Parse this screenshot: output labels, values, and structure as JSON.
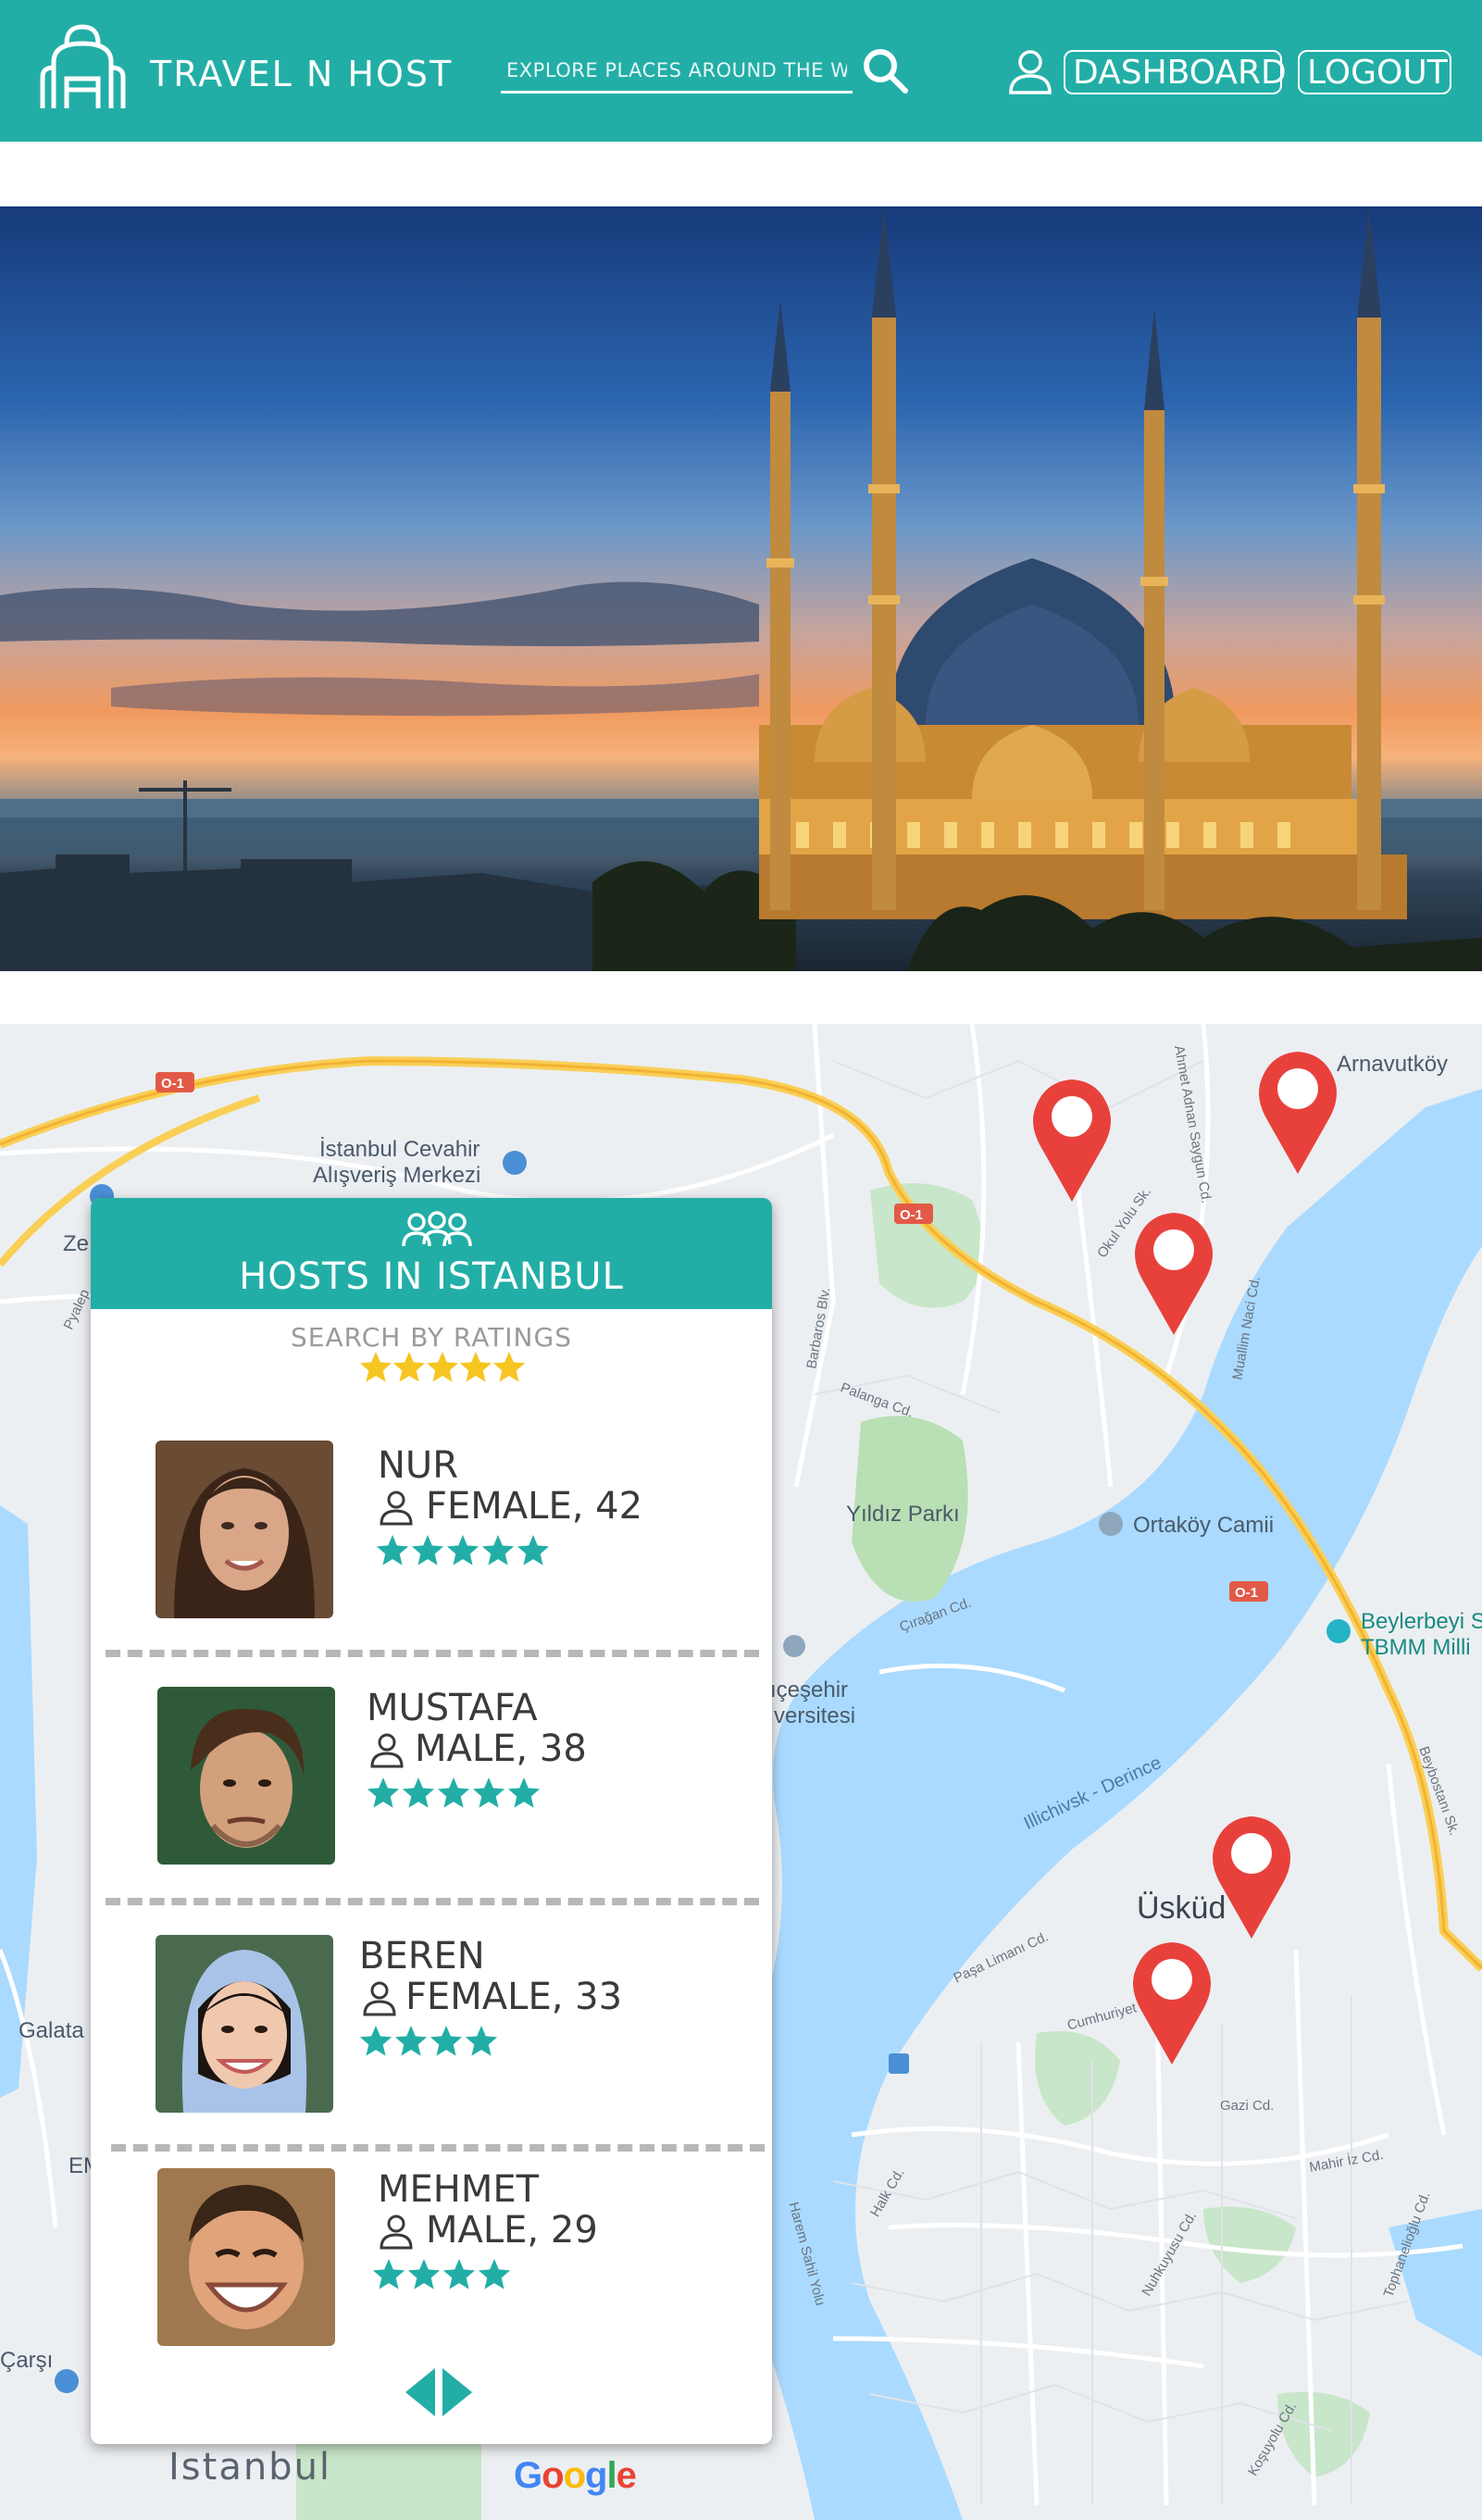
{
  "header": {
    "brand": "TRAVEL N HOST",
    "search_placeholder": "EXPLORE PLACES AROUND THE WORLD",
    "dashboard_label": "DASHBOARD",
    "logout_label": "LOGOUT",
    "icons": [
      "backpack-icon",
      "search-icon",
      "user-icon"
    ],
    "colors": {
      "primary": "#22aea6",
      "text": "#ffffff"
    }
  },
  "hero": {
    "image": "Blue Mosque at sunset, Istanbul"
  },
  "map": {
    "labels": {
      "istanbul_cevahir": "İstanbul Cevahir",
      "alisveris": "Alışveriş Merkezi",
      "arnavutkoy": "Arnavutköy",
      "yildiz": "Yıldız Parkı",
      "ortakoy": "Ortaköy Camii",
      "beylerbeyi": "Beylerbeyi S",
      "tbmm": "TBMM Milli",
      "cesehir": "ıçeşehir",
      "versitesi": "versitesi",
      "uskudar": "Üsküd",
      "galata": "Galata",
      "istanbul": "Istanbul",
      "ze": "Ze",
      "carsi": "Çarşı",
      "road_o1": "O-1",
      "illichivsk": "Illichivsk - Derince",
      "muallim": "Muallim Naci Cd.",
      "barbaros": "Barbaros Blv.",
      "palanga": "Palanga Cd.",
      "ciragan": "Çırağan Cd.",
      "okul_yolu": "Okul Yolu Sk.",
      "ahmet_adnan": "Ahmet Adnan Saygun Cd.",
      "pasa_limani": "Paşa Limanı Cd.",
      "cumhuriyet": "Cumhuriyet",
      "gazi": "Gazi Cd.",
      "halk": "Halk Cd.",
      "nuhkuyusu": "Nuhkuyusu Cd.",
      "mahir": "Mahir İz Cd.",
      "tophanelioglu": "Tophanelioğlu Cd.",
      "harem": "Harem Sahil Yolu",
      "beybostani": "Beybostanı Sk.",
      "kosuyolu": "Koşuyolu Cd.",
      "pyalepa": "Pyalep",
      "em": "EM"
    },
    "google_logo": [
      "G",
      "o",
      "o",
      "g",
      "l",
      "e"
    ],
    "google_colors": [
      "#4285f4",
      "#ea4335",
      "#fbbc05",
      "#4285f4",
      "#34a853",
      "#ea4335"
    ],
    "pin_color": "#e8413c"
  },
  "panel": {
    "title": "HOSTS IN ISTANBUL",
    "search_ratings_label": "SEARCH BY RATINGS",
    "filter_star_color": "#f6c521",
    "host_star_color": "#22aea6",
    "hosts": [
      {
        "name": "NUR",
        "info": "FEMALE, 42",
        "rating": 5
      },
      {
        "name": "MUSTAFA",
        "info": "MALE, 38",
        "rating": 5
      },
      {
        "name": "BEREN",
        "info": "FEMALE, 33",
        "rating": 4
      },
      {
        "name": "MEHMET",
        "info": "MALE, 29",
        "rating": 4
      }
    ]
  }
}
